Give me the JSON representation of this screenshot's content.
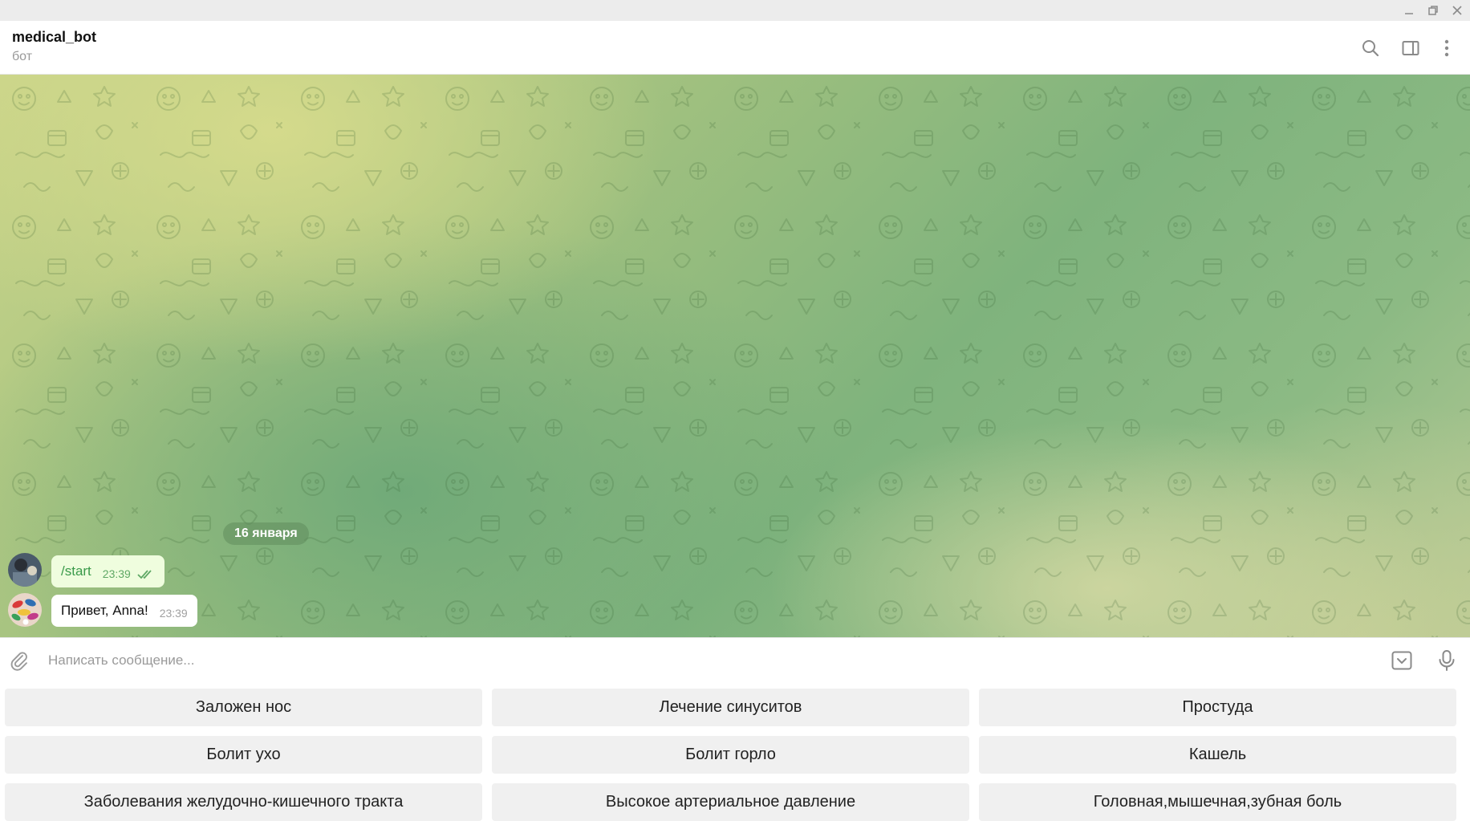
{
  "window": {
    "minimize_icon": "minimize-icon",
    "maximize_icon": "maximize-icon",
    "close_icon": "close-icon"
  },
  "header": {
    "title": "medical_bot",
    "subtitle": "бот",
    "icons": [
      "search-icon",
      "sidebar-toggle-icon",
      "more-vertical-icon"
    ]
  },
  "chat": {
    "date_separator": "16 января",
    "messages": [
      {
        "direction": "outgoing",
        "text": "/start",
        "time": "23:39",
        "status": "read"
      },
      {
        "direction": "incoming",
        "text": "Привет, Anna!",
        "time": "23:39"
      }
    ],
    "colors": {
      "outgoing_bubble": "#effdde",
      "outgoing_text": "#3a9a4a",
      "incoming_bubble": "#ffffff",
      "time_out": "#5fa865",
      "time_in": "#a0a0a0"
    }
  },
  "composer": {
    "placeholder": "Написать сообщение..."
  },
  "keyboard": {
    "rows": [
      [
        "Заложен нос",
        "Лечение синуситов",
        "Простуда"
      ],
      [
        "Болит ухо",
        "Болит горло",
        "Кашель"
      ],
      [
        "Заболевания желудочно-кишечного тракта",
        "Высокое артериальное давление",
        "Головная,мышечная,зубная боль"
      ]
    ]
  }
}
